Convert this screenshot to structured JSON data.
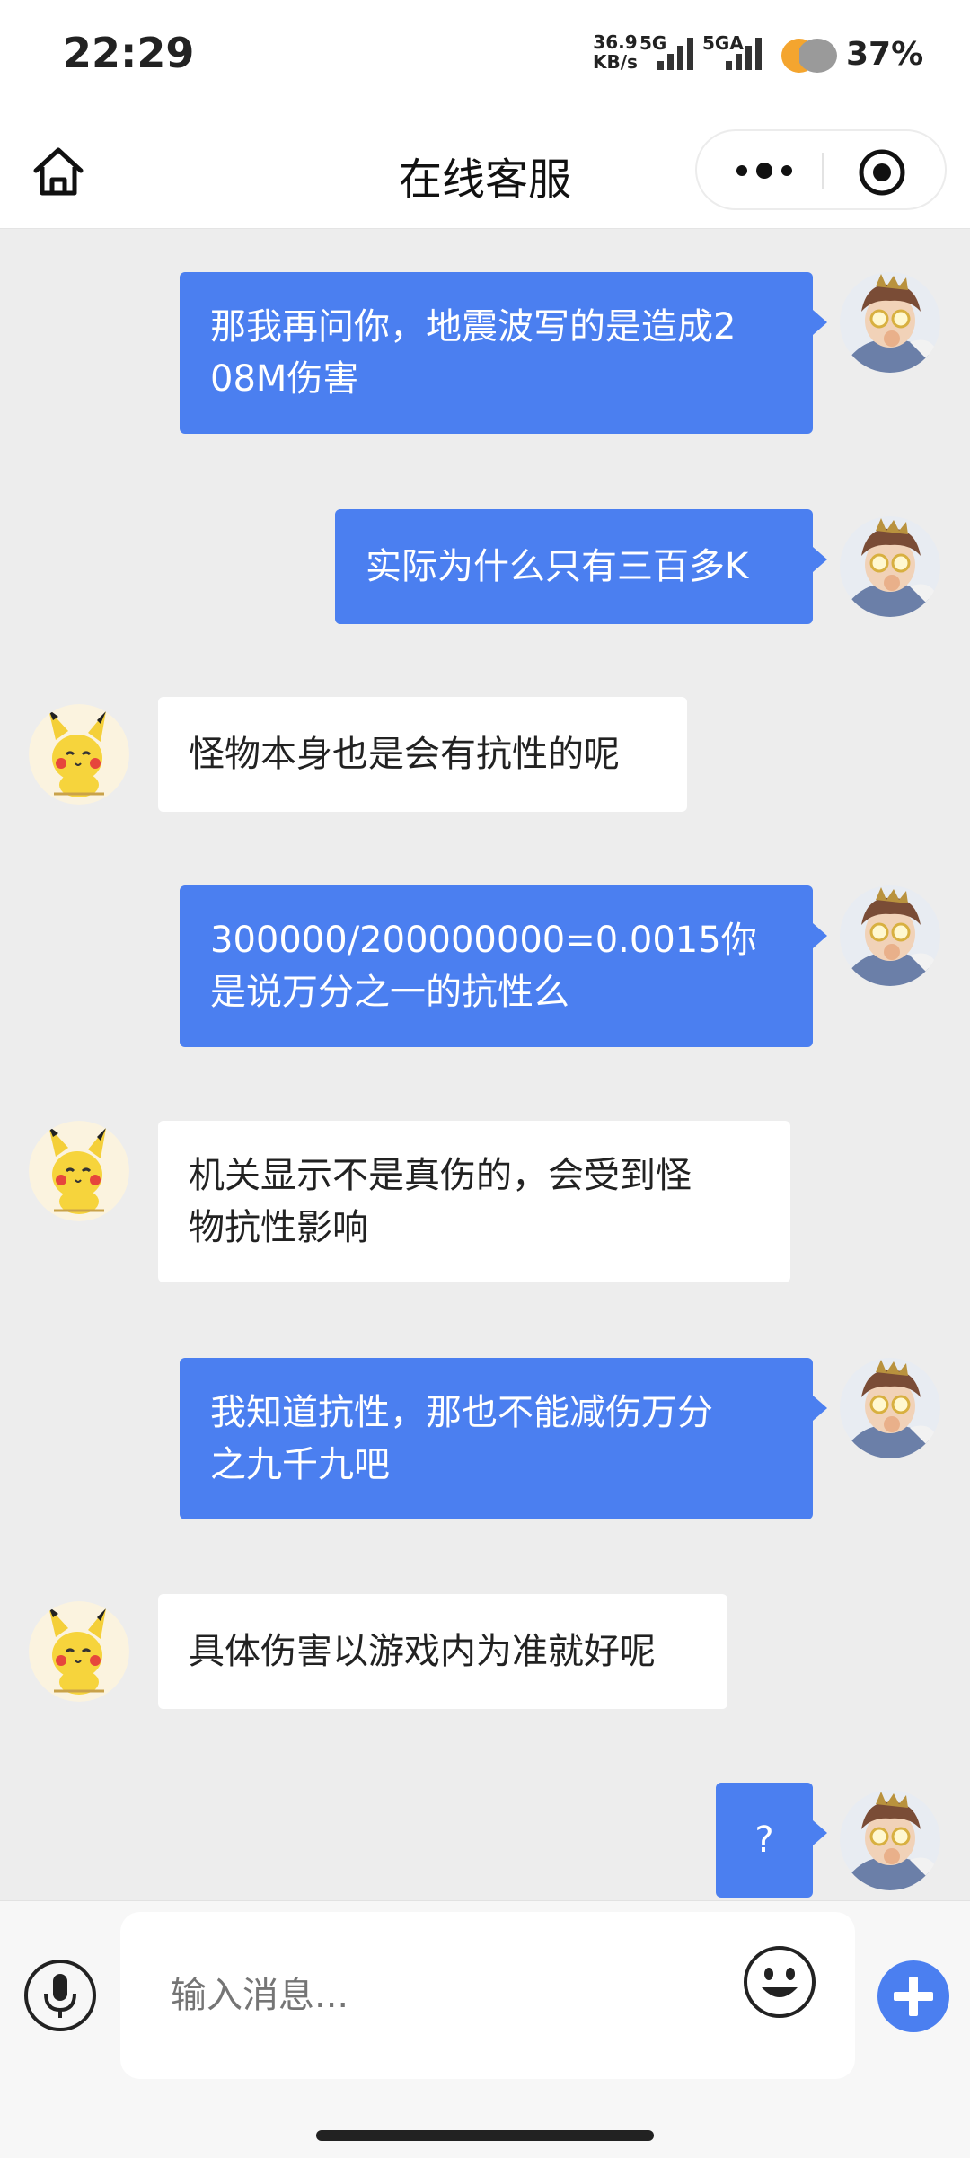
{
  "status_bar": {
    "time": "22:29",
    "net_speed_value": "36.9",
    "net_speed_unit": "KB/s",
    "sim1": "5G",
    "sim2": "5GA",
    "battery": "37%"
  },
  "header": {
    "title": "在线客服"
  },
  "messages": [
    {
      "from": "me",
      "lines": [
        "那我再问你，地震波写的是造成2",
        "08M伤害"
      ]
    },
    {
      "from": "me",
      "lines": [
        "实际为什么只有三百多K"
      ]
    },
    {
      "from": "agent",
      "lines": [
        "怪物本身也是会有抗性的呢"
      ]
    },
    {
      "from": "me",
      "lines": [
        "300000/200000000=0.0015你",
        "是说万分之一的抗性么"
      ]
    },
    {
      "from": "agent",
      "lines": [
        "机关显示不是真伤的，会受到怪",
        "物抗性影响"
      ]
    },
    {
      "from": "me",
      "lines": [
        "我知道抗性，那也不能减伤万分",
        "之九千九吧"
      ]
    },
    {
      "from": "agent",
      "lines": [
        "具体伤害以游戏内为准就好呢"
      ]
    },
    {
      "from": "me",
      "lines": [
        "?"
      ]
    }
  ],
  "input": {
    "placeholder": "输入消息..."
  },
  "icons": {
    "home": "home-icon",
    "more": "more-dots-icon",
    "target": "target-icon",
    "voice": "microphone-icon",
    "emoji": "emoji-icon",
    "plus": "plus-icon"
  },
  "colors": {
    "my_bubble": "#4b7ff0",
    "agent_bubble": "#ffffff",
    "chat_background": "#ededed",
    "plus_button": "#4b7ff0"
  }
}
